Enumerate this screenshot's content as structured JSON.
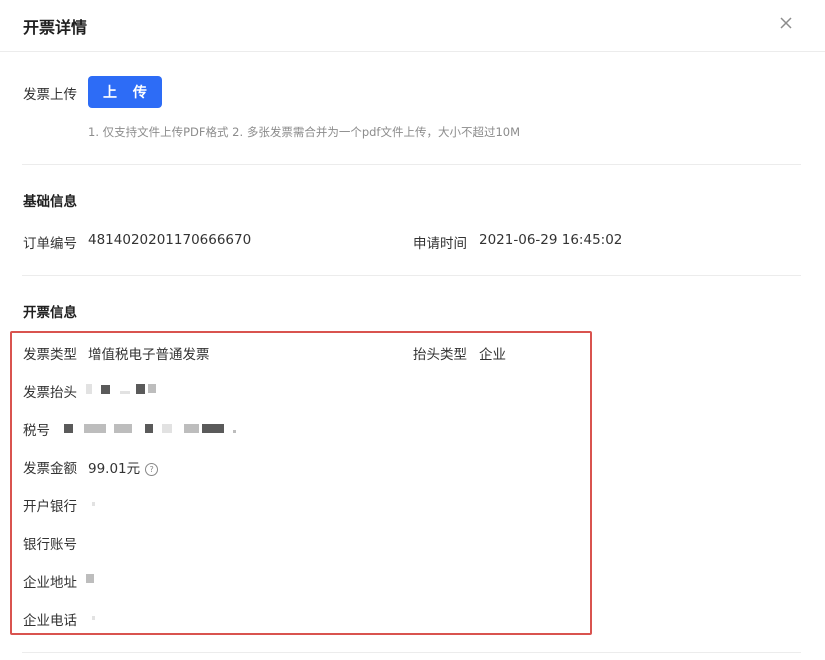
{
  "dialog": {
    "title": "开票详情"
  },
  "upload": {
    "label": "发票上传",
    "button_label": "上 传",
    "hint": "1. 仅支持文件上传PDF格式 2. 多张发票需合并为一个pdf文件上传，大小不超过10M"
  },
  "basic_info": {
    "title": "基础信息",
    "order_no_label": "订单编号",
    "order_no_value": "4814020201170666670",
    "apply_time_label": "申请时间",
    "apply_time_value": "2021-06-29 16:45:02"
  },
  "invoice_info": {
    "title": "开票信息",
    "invoice_type_label": "发票类型",
    "invoice_type_value": "增值税电子普通发票",
    "header_type_label": "抬头类型",
    "header_type_value": "企业",
    "invoice_header_label": "发票抬头",
    "tax_no_label": "税号",
    "amount_label": "发票金额",
    "amount_value": "99.01元",
    "bank_label": "开户银行",
    "account_label": "银行账号",
    "address_label": "企业地址",
    "phone_label": "企业电话"
  },
  "colors": {
    "accent": "#2d6cf6",
    "highlight": "#d9534f"
  }
}
